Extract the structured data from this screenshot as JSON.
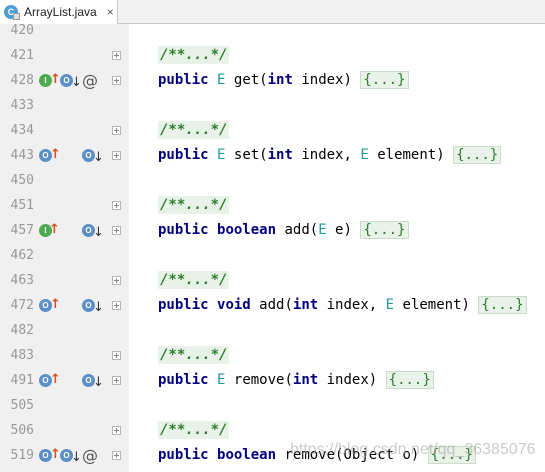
{
  "tab": {
    "label": "ArrayList.java",
    "icon": "java-class-icon",
    "icon_letter": "C",
    "close": "×"
  },
  "watermark": "https://blog.csdn.net/qq_36385076",
  "lines": [
    {
      "num": "420"
    },
    {
      "num": "421",
      "code": "comment",
      "text": "/**...*/"
    },
    {
      "num": "428",
      "code": "method",
      "mods": [
        "public"
      ],
      "ret": "E",
      "name": "get",
      "params": [
        {
          "type": "int",
          "name": "index"
        }
      ],
      "icons": [
        "I",
        "up",
        "O",
        "down",
        "@"
      ]
    },
    {
      "num": "433"
    },
    {
      "num": "434",
      "code": "comment",
      "text": "/**...*/"
    },
    {
      "num": "443",
      "code": "method",
      "mods": [
        "public"
      ],
      "ret": "E",
      "name": "set",
      "params": [
        {
          "type": "int",
          "name": "index"
        },
        {
          "type": "E",
          "name": "element"
        }
      ],
      "icons": [
        "O",
        "up",
        "O2",
        "down"
      ]
    },
    {
      "num": "450"
    },
    {
      "num": "451",
      "code": "comment",
      "text": "/**...*/"
    },
    {
      "num": "457",
      "code": "method",
      "mods": [
        "public",
        "boolean"
      ],
      "ret": "",
      "name": "add",
      "params": [
        {
          "type": "E",
          "name": "e"
        }
      ],
      "icons": [
        "IO",
        "O2",
        "down"
      ]
    },
    {
      "num": "462"
    },
    {
      "num": "463",
      "code": "comment",
      "text": "/**...*/"
    },
    {
      "num": "472",
      "code": "method",
      "mods": [
        "public",
        "void"
      ],
      "ret": "",
      "name": "add",
      "params": [
        {
          "type": "int",
          "name": "index"
        },
        {
          "type": "E",
          "name": "element"
        }
      ],
      "icons": [
        "O",
        "up",
        "O2",
        "down"
      ]
    },
    {
      "num": "482"
    },
    {
      "num": "483",
      "code": "comment",
      "text": "/**...*/"
    },
    {
      "num": "491",
      "code": "method",
      "mods": [
        "public"
      ],
      "ret": "E",
      "name": "remove",
      "params": [
        {
          "type": "int",
          "name": "index"
        }
      ],
      "icons": [
        "O",
        "up",
        "O2",
        "down"
      ]
    },
    {
      "num": "505"
    },
    {
      "num": "506",
      "code": "comment",
      "text": "/**...*/"
    },
    {
      "num": "519",
      "code": "method",
      "mods": [
        "public",
        "boolean"
      ],
      "ret": "",
      "name": "remove",
      "params": [
        {
          "type": "Object",
          "name": "o"
        }
      ],
      "icons": [
        "O",
        "up",
        "O",
        "down",
        "@"
      ]
    }
  ],
  "folded_body": "{...}"
}
